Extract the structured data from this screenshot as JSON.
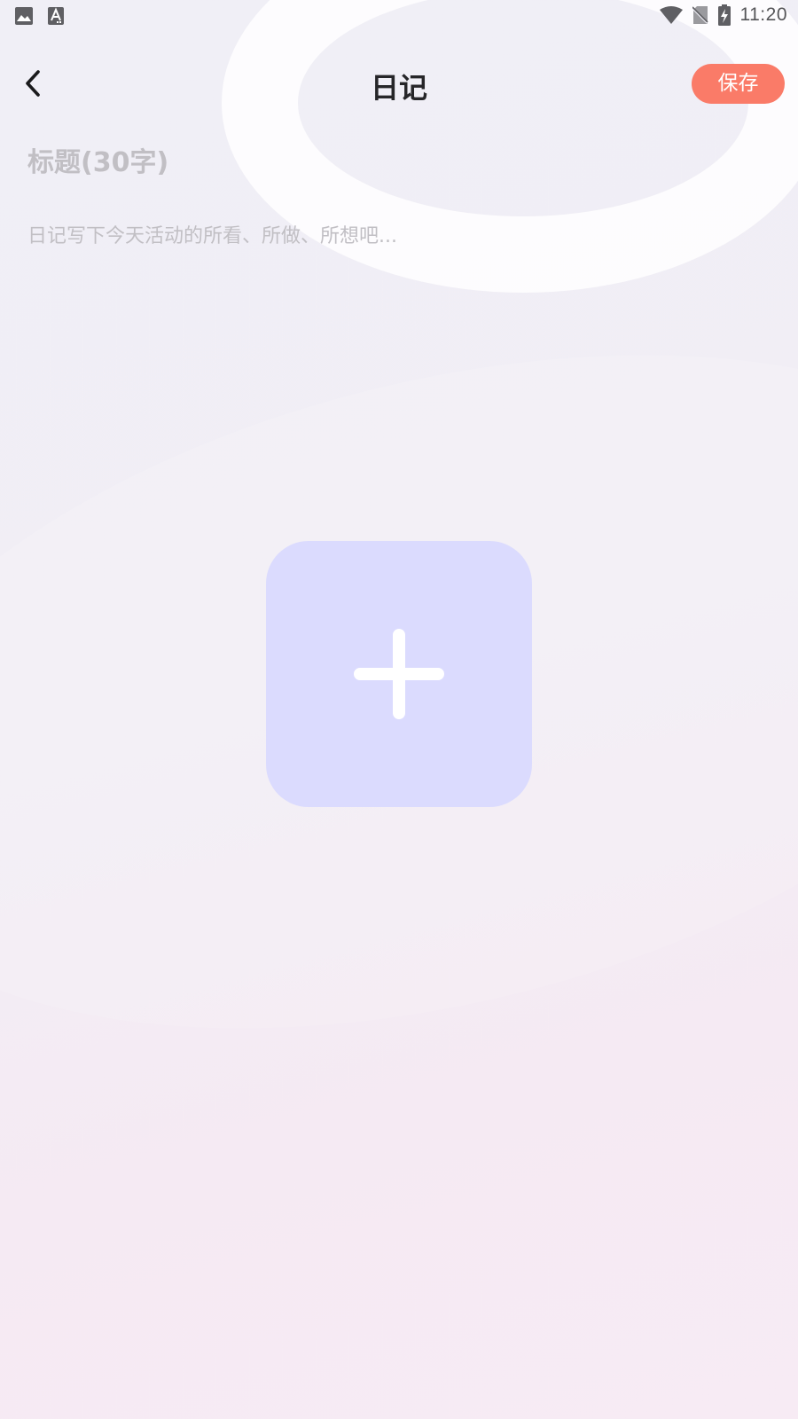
{
  "status_bar": {
    "time": "11:20",
    "left_icons": [
      "image-icon",
      "text-input-icon"
    ],
    "right_icons": [
      "wifi-icon",
      "no-sim-icon",
      "battery-charging-icon"
    ]
  },
  "header": {
    "title": "日记",
    "save_label": "保存",
    "back_icon": "chevron-left-icon"
  },
  "editor": {
    "title_placeholder": "标题(30字)",
    "body_placeholder": "日记写下今天活动的所看、所做、所想吧..."
  },
  "add_image": {
    "icon": "plus-icon"
  },
  "colors": {
    "save_button": "#fa7b68",
    "add_tile": "#dbdbfe",
    "placeholder_text": "#c1bfc4",
    "title_text": "#262629"
  }
}
